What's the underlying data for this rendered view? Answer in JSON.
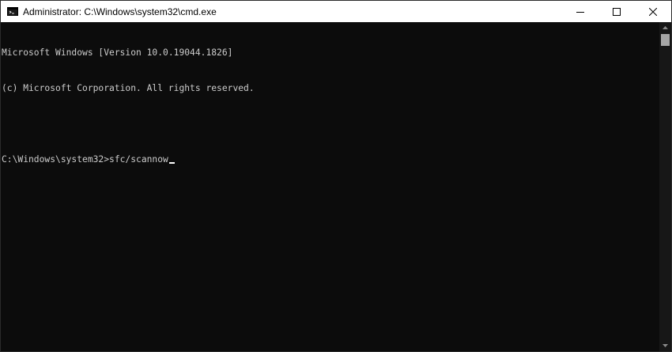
{
  "window": {
    "title": "Administrator: C:\\Windows\\system32\\cmd.exe",
    "icon": "cmd-console-icon"
  },
  "controls": {
    "minimize": "minimize-icon",
    "maximize": "maximize-icon",
    "close": "close-icon"
  },
  "console": {
    "lines": [
      "Microsoft Windows [Version 10.0.19044.1826]",
      "(c) Microsoft Corporation. All rights reserved.",
      "",
      "C:\\Windows\\system32>sfc/scannow"
    ]
  },
  "colors": {
    "background": "#0c0c0c",
    "text": "#cccccc",
    "titlebar": "#ffffff"
  }
}
